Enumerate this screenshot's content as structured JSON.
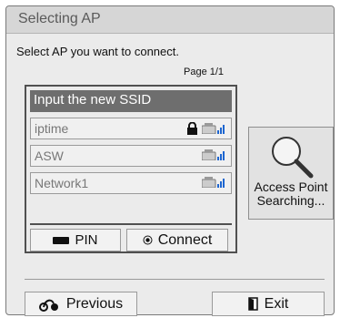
{
  "dialog": {
    "title": "Selecting AP",
    "instruction": "Select AP you want to connect.",
    "page_indicator": "Page 1/1"
  },
  "ap_list": {
    "input_label": "Input the new SSID",
    "items": [
      {
        "name": "iptime",
        "locked": true,
        "signal_icon": "wifi-signal-icon"
      },
      {
        "name": "ASW",
        "locked": false,
        "signal_icon": "wifi-signal-icon"
      },
      {
        "name": "Network1",
        "locked": false,
        "signal_icon": "wifi-signal-icon"
      }
    ]
  },
  "buttons": {
    "pin_label": "PIN",
    "connect_label": "Connect",
    "search_label_line1": "Access Point",
    "search_label_line2": "Searching...",
    "previous_label": "Previous",
    "exit_label": "Exit"
  },
  "colors": {
    "accent_signal": "#1e66d0",
    "highlight_bg": "#6e6e6e",
    "panel_border": "#505050"
  }
}
